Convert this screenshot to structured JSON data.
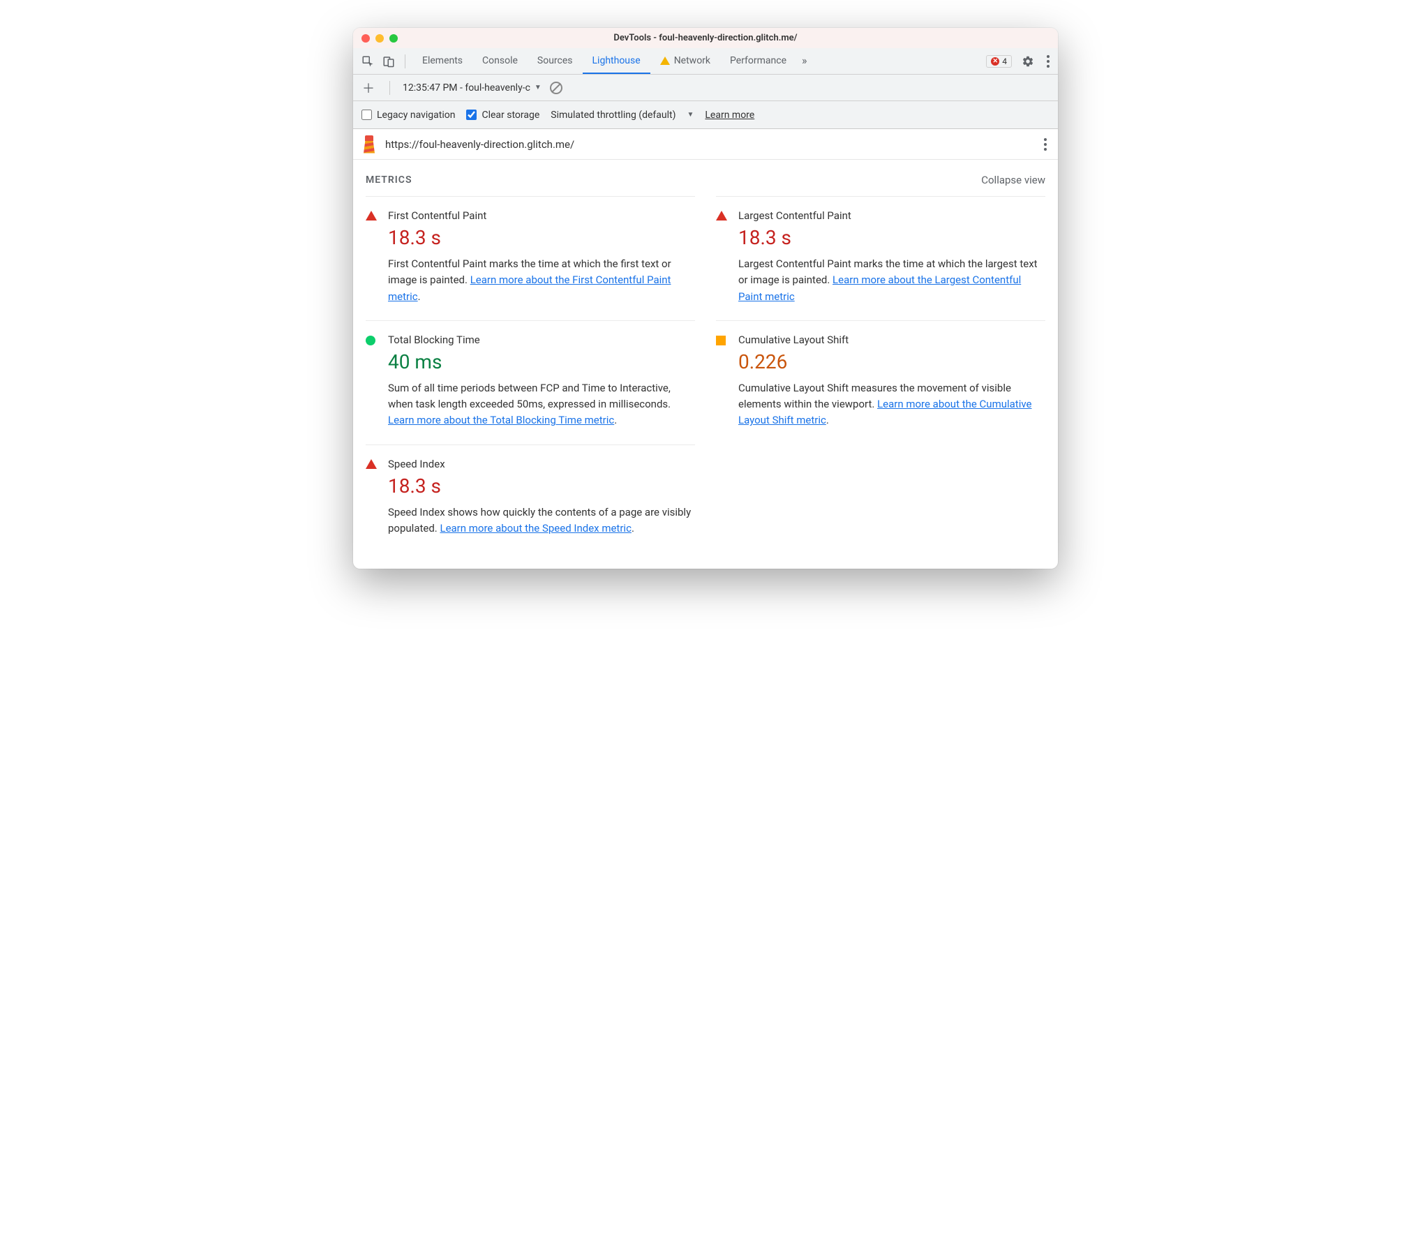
{
  "window": {
    "title": "DevTools - foul-heavenly-direction.glitch.me/"
  },
  "tabs": {
    "elements": "Elements",
    "console": "Console",
    "sources": "Sources",
    "lighthouse": "Lighthouse",
    "network": "Network",
    "performance": "Performance"
  },
  "errors": {
    "count": "4"
  },
  "subbar": {
    "report_label": "12:35:47 PM - foul-heavenly-c"
  },
  "options": {
    "legacy_label": "Legacy navigation",
    "clear_label": "Clear storage",
    "throttling_label": "Simulated throttling (default)",
    "learn_more": "Learn more"
  },
  "url": "https://foul-heavenly-direction.glitch.me/",
  "section": {
    "title": "METRICS",
    "collapse": "Collapse view"
  },
  "metrics": {
    "fcp": {
      "title": "First Contentful Paint",
      "value": "18.3 s",
      "desc": "First Contentful Paint marks the time at which the first text or image is painted. ",
      "link": "Learn more about the First Contentful Paint metric",
      "period": "."
    },
    "lcp": {
      "title": "Largest Contentful Paint",
      "value": "18.3 s",
      "desc": "Largest Contentful Paint marks the time at which the largest text or image is painted. ",
      "link": "Learn more about the Largest Contentful Paint metric",
      "period": ""
    },
    "tbt": {
      "title": "Total Blocking Time",
      "value": "40 ms",
      "desc": "Sum of all time periods between FCP and Time to Interactive, when task length exceeded 50ms, expressed in milliseconds. ",
      "link": "Learn more about the Total Blocking Time metric",
      "period": "."
    },
    "cls": {
      "title": "Cumulative Layout Shift",
      "value": "0.226",
      "desc": "Cumulative Layout Shift measures the movement of visible elements within the viewport. ",
      "link": "Learn more about the Cumulative Layout Shift metric",
      "period": "."
    },
    "si": {
      "title": "Speed Index",
      "value": "18.3 s",
      "desc": "Speed Index shows how quickly the contents of a page are visibly populated. ",
      "link": "Learn more about the Speed Index metric",
      "period": "."
    }
  }
}
